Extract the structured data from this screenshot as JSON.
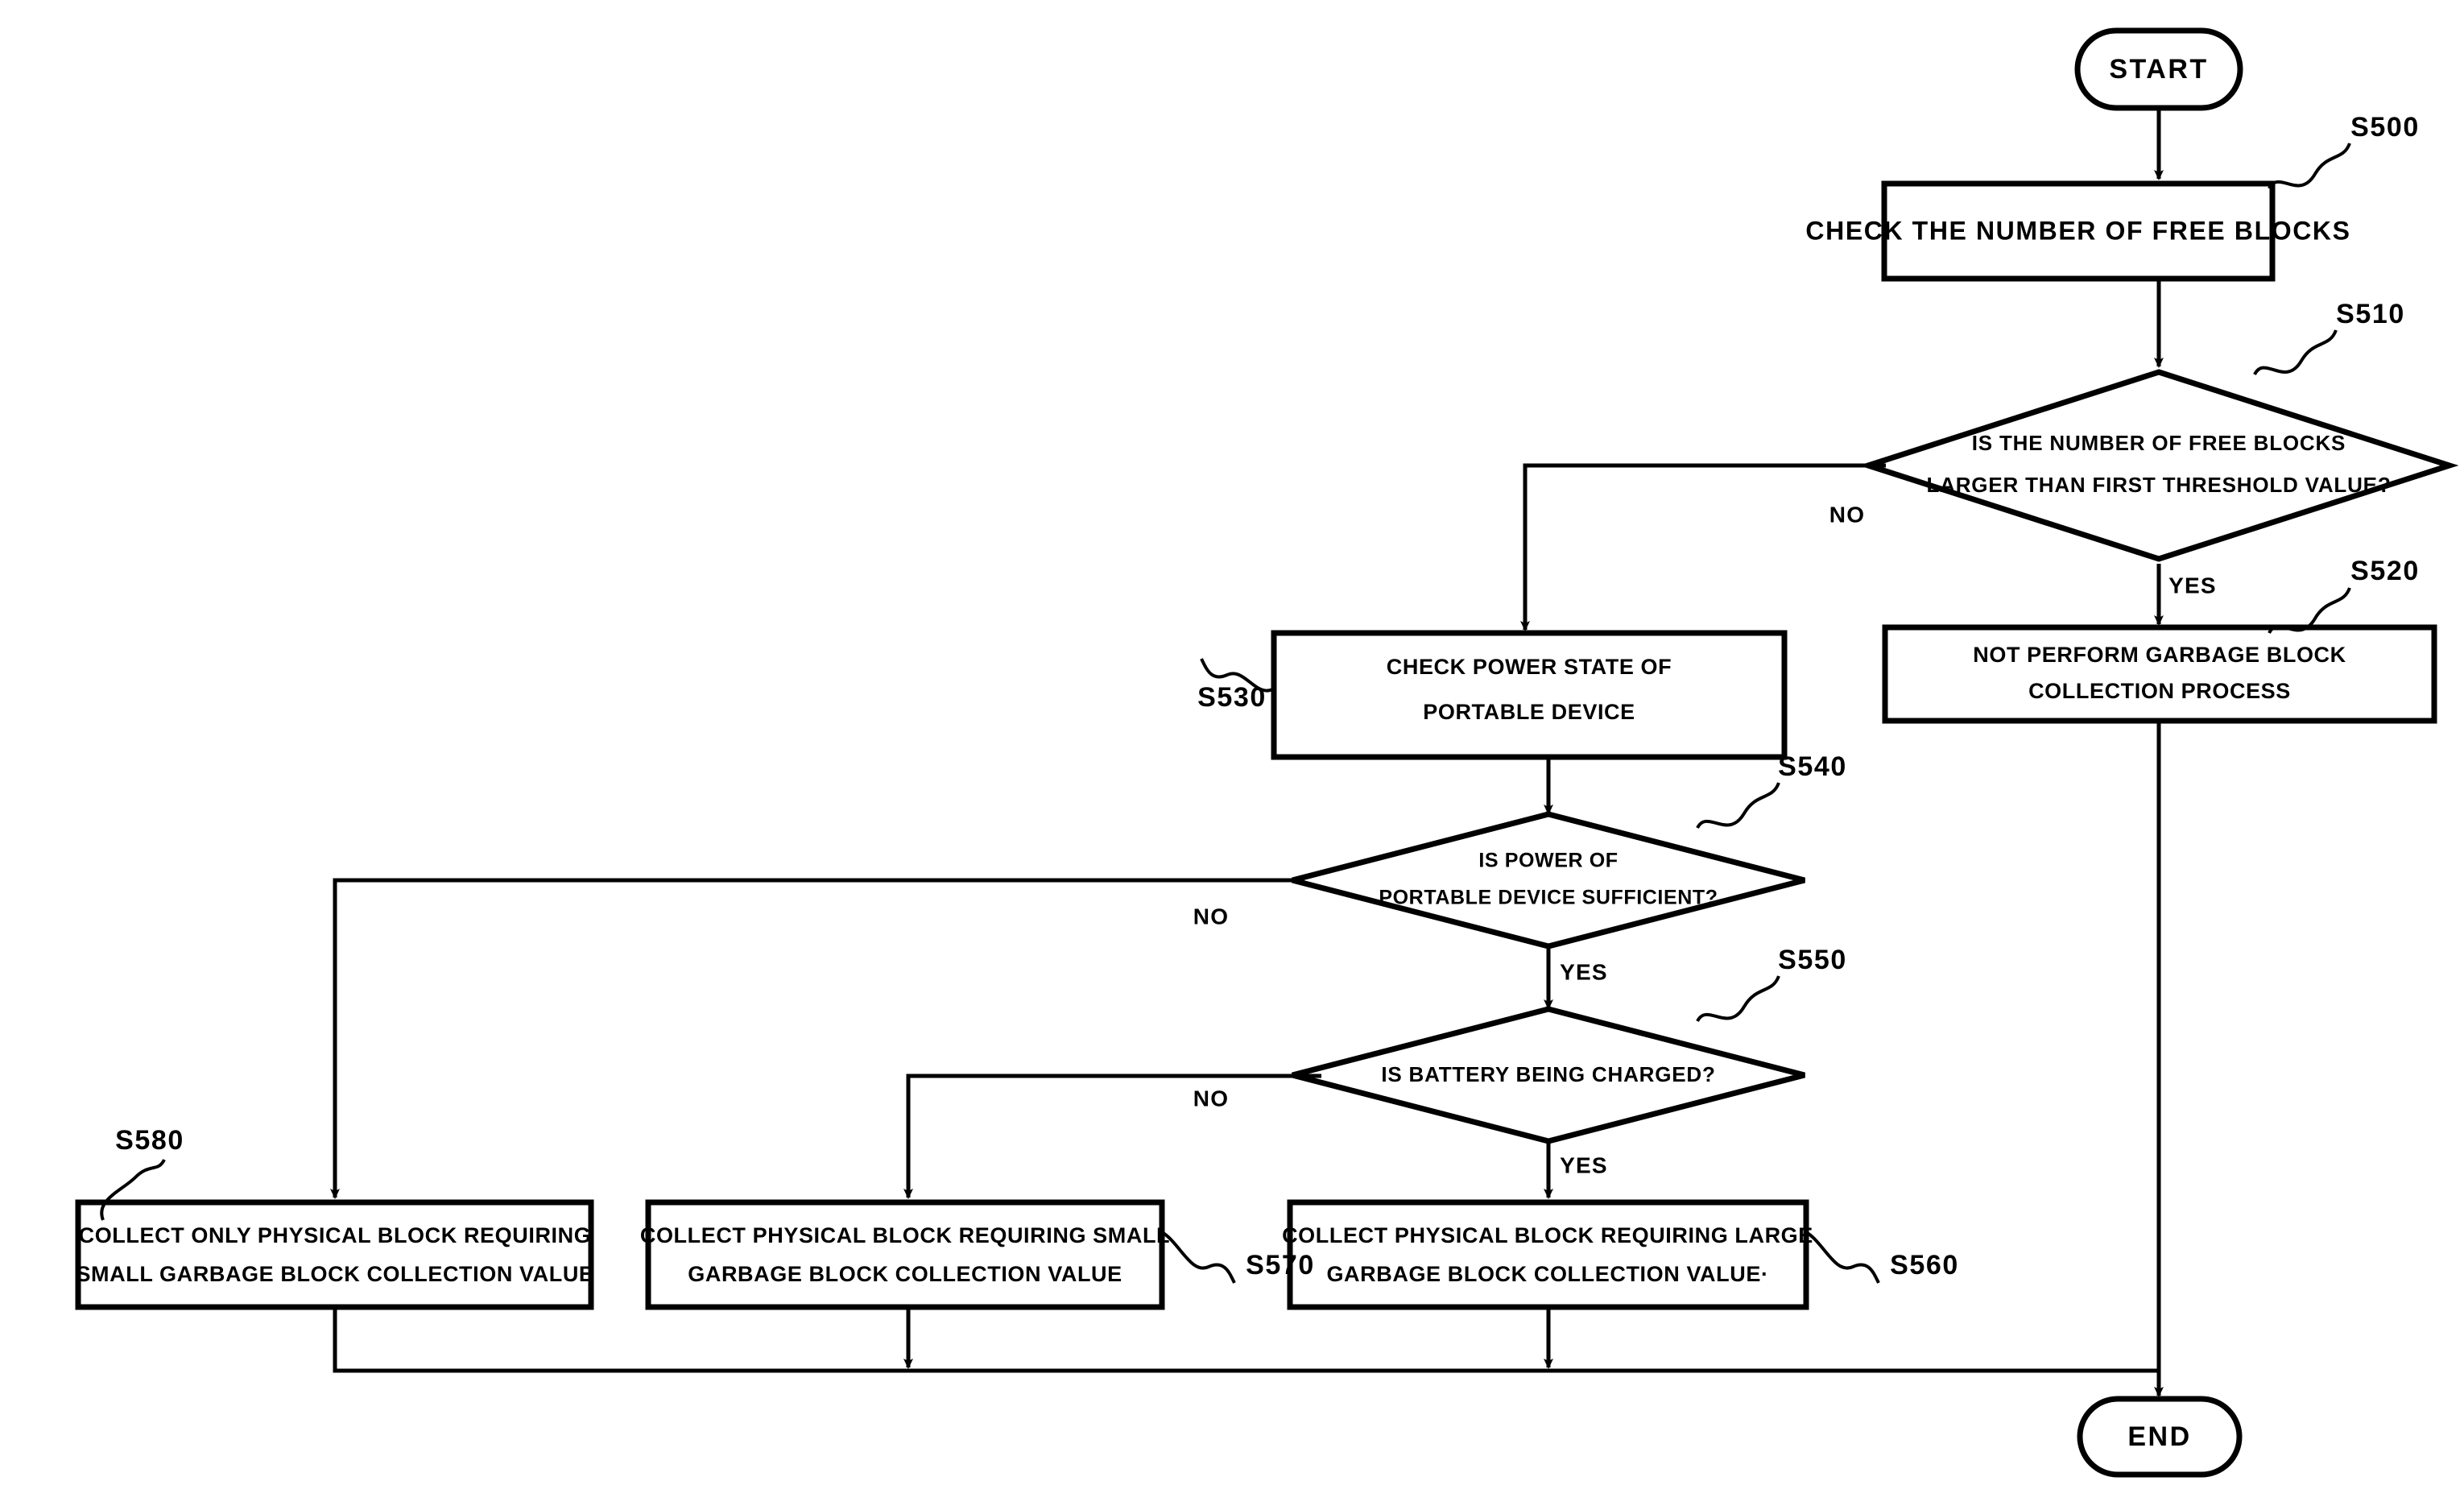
{
  "diagram": {
    "title": "Garbage Block Collection Process Flowchart",
    "stroke_color": "#000000",
    "fill_color": "#ffffff",
    "background": "#ffffff"
  },
  "nodes": {
    "start": {
      "label": "START",
      "shape": "terminal"
    },
    "s500": {
      "label": "CHECK THE NUMBER OF FREE BLOCKS",
      "ref": "S500",
      "shape": "process"
    },
    "s510": {
      "line1": "IS THE NUMBER OF FREE BLOCKS",
      "line2": "LARGER THAN FIRST THRESHOLD VALUE?",
      "ref": "S510",
      "shape": "decision"
    },
    "s520": {
      "line1": "NOT PERFORM GARBAGE BLOCK",
      "line2": "COLLECTION PROCESS",
      "ref": "S520",
      "shape": "process"
    },
    "s530": {
      "line1": "CHECK POWER STATE OF",
      "line2": "PORTABLE DEVICE",
      "ref": "S530",
      "shape": "process"
    },
    "s540": {
      "line1": "IS POWER OF",
      "line2": "PORTABLE DEVICE SUFFICIENT?",
      "ref": "S540",
      "shape": "decision"
    },
    "s550": {
      "line1": "IS BATTERY BEING CHARGED?",
      "line2": "",
      "ref": "S550",
      "shape": "decision"
    },
    "s560": {
      "line1": "COLLECT PHYSICAL BLOCK REQUIRING LARGE",
      "line2": "GARBAGE BLOCK COLLECTION VALUE·",
      "ref": "S560",
      "shape": "process"
    },
    "s570": {
      "line1": "COLLECT PHYSICAL BLOCK REQUIRING SMALL",
      "line2": "GARBAGE BLOCK COLLECTION VALUE",
      "ref": "S570",
      "shape": "process"
    },
    "s580": {
      "line1": "COLLECT ONLY PHYSICAL BLOCK REQUIRING",
      "line2": "SMALL GARBAGE BLOCK COLLECTION VALUE",
      "ref": "S580",
      "shape": "process"
    },
    "end": {
      "label": "END",
      "shape": "terminal"
    }
  },
  "branch_labels": {
    "s510_no": "NO",
    "s510_yes": "YES",
    "s540_no": "NO",
    "s540_yes": "YES",
    "s550_no": "NO",
    "s550_yes": "YES"
  }
}
